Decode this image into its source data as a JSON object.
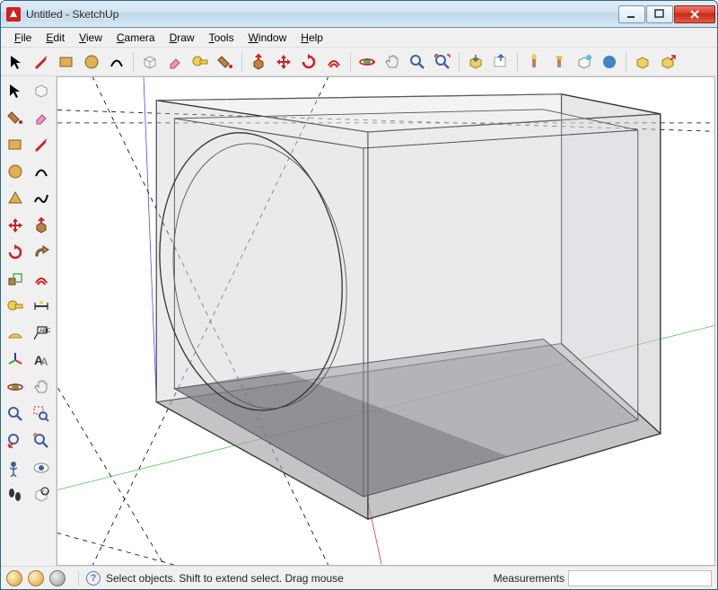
{
  "window": {
    "title": "Untitled - SketchUp"
  },
  "menu": [
    {
      "label": "File",
      "u": 0
    },
    {
      "label": "Edit",
      "u": 0
    },
    {
      "label": "View",
      "u": 0
    },
    {
      "label": "Camera",
      "u": 0
    },
    {
      "label": "Draw",
      "u": 0
    },
    {
      "label": "Tools",
      "u": 0
    },
    {
      "label": "Window",
      "u": 0
    },
    {
      "label": "Help",
      "u": 0
    }
  ],
  "statusbar": {
    "hint": "Select objects. Shift to extend select. Drag mouse",
    "measurements_label": "Measurements",
    "measurements_value": ""
  }
}
